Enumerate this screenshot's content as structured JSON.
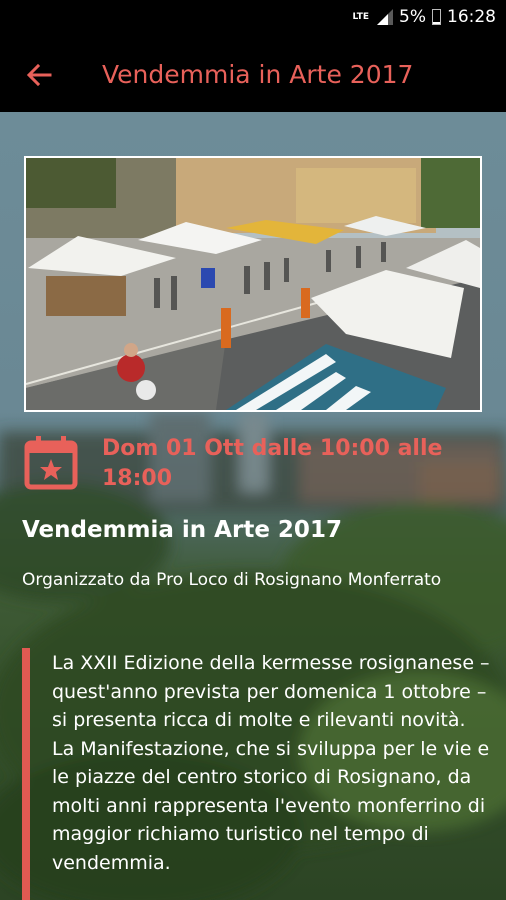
{
  "status_bar": {
    "network": "LTE",
    "battery": "5%",
    "time": "16:28"
  },
  "app_bar": {
    "title": "Vendemmia in Arte 2017"
  },
  "event": {
    "date": "Dom 01 Ott dalle 10:00 alle 18:00",
    "title": "Vendemmia in Arte 2017",
    "organizer": "Organizzato da Pro Loco di Rosignano Monferrato",
    "description_p1": "La XXII Edizione della kermesse rosignanese – quest'anno prevista per domenica 1 ottobre – si presenta ricca di molte e rilevanti novità.",
    "description_p2": "La Manifestazione, che si sviluppa per le vie e le piazze del centro storico di Rosignano, da molti anni rappresenta l'evento monferrino di maggior richiamo turistico nel tempo di vendemmia."
  },
  "colors": {
    "accent": "#e8615a",
    "app_bar_bg": "#000000",
    "text": "#ffffff"
  },
  "icons": {
    "back": "arrow-left-icon",
    "calendar": "calendar-star-icon"
  }
}
